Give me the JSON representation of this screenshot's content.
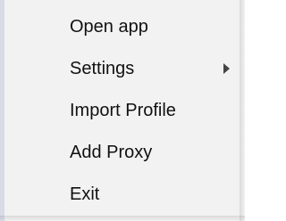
{
  "context_menu": {
    "items": [
      {
        "label": "Open app"
      },
      {
        "label": "Settings",
        "has_submenu": true
      },
      {
        "label": "Import Profile"
      },
      {
        "label": "Add Proxy"
      },
      {
        "label": "Exit"
      }
    ]
  },
  "icons": {
    "submenu_arrow": "chevron-right-icon"
  },
  "colors": {
    "menu_background": "#f2f2f2",
    "left_strip": "#d9dbe6",
    "text": "#111111"
  }
}
